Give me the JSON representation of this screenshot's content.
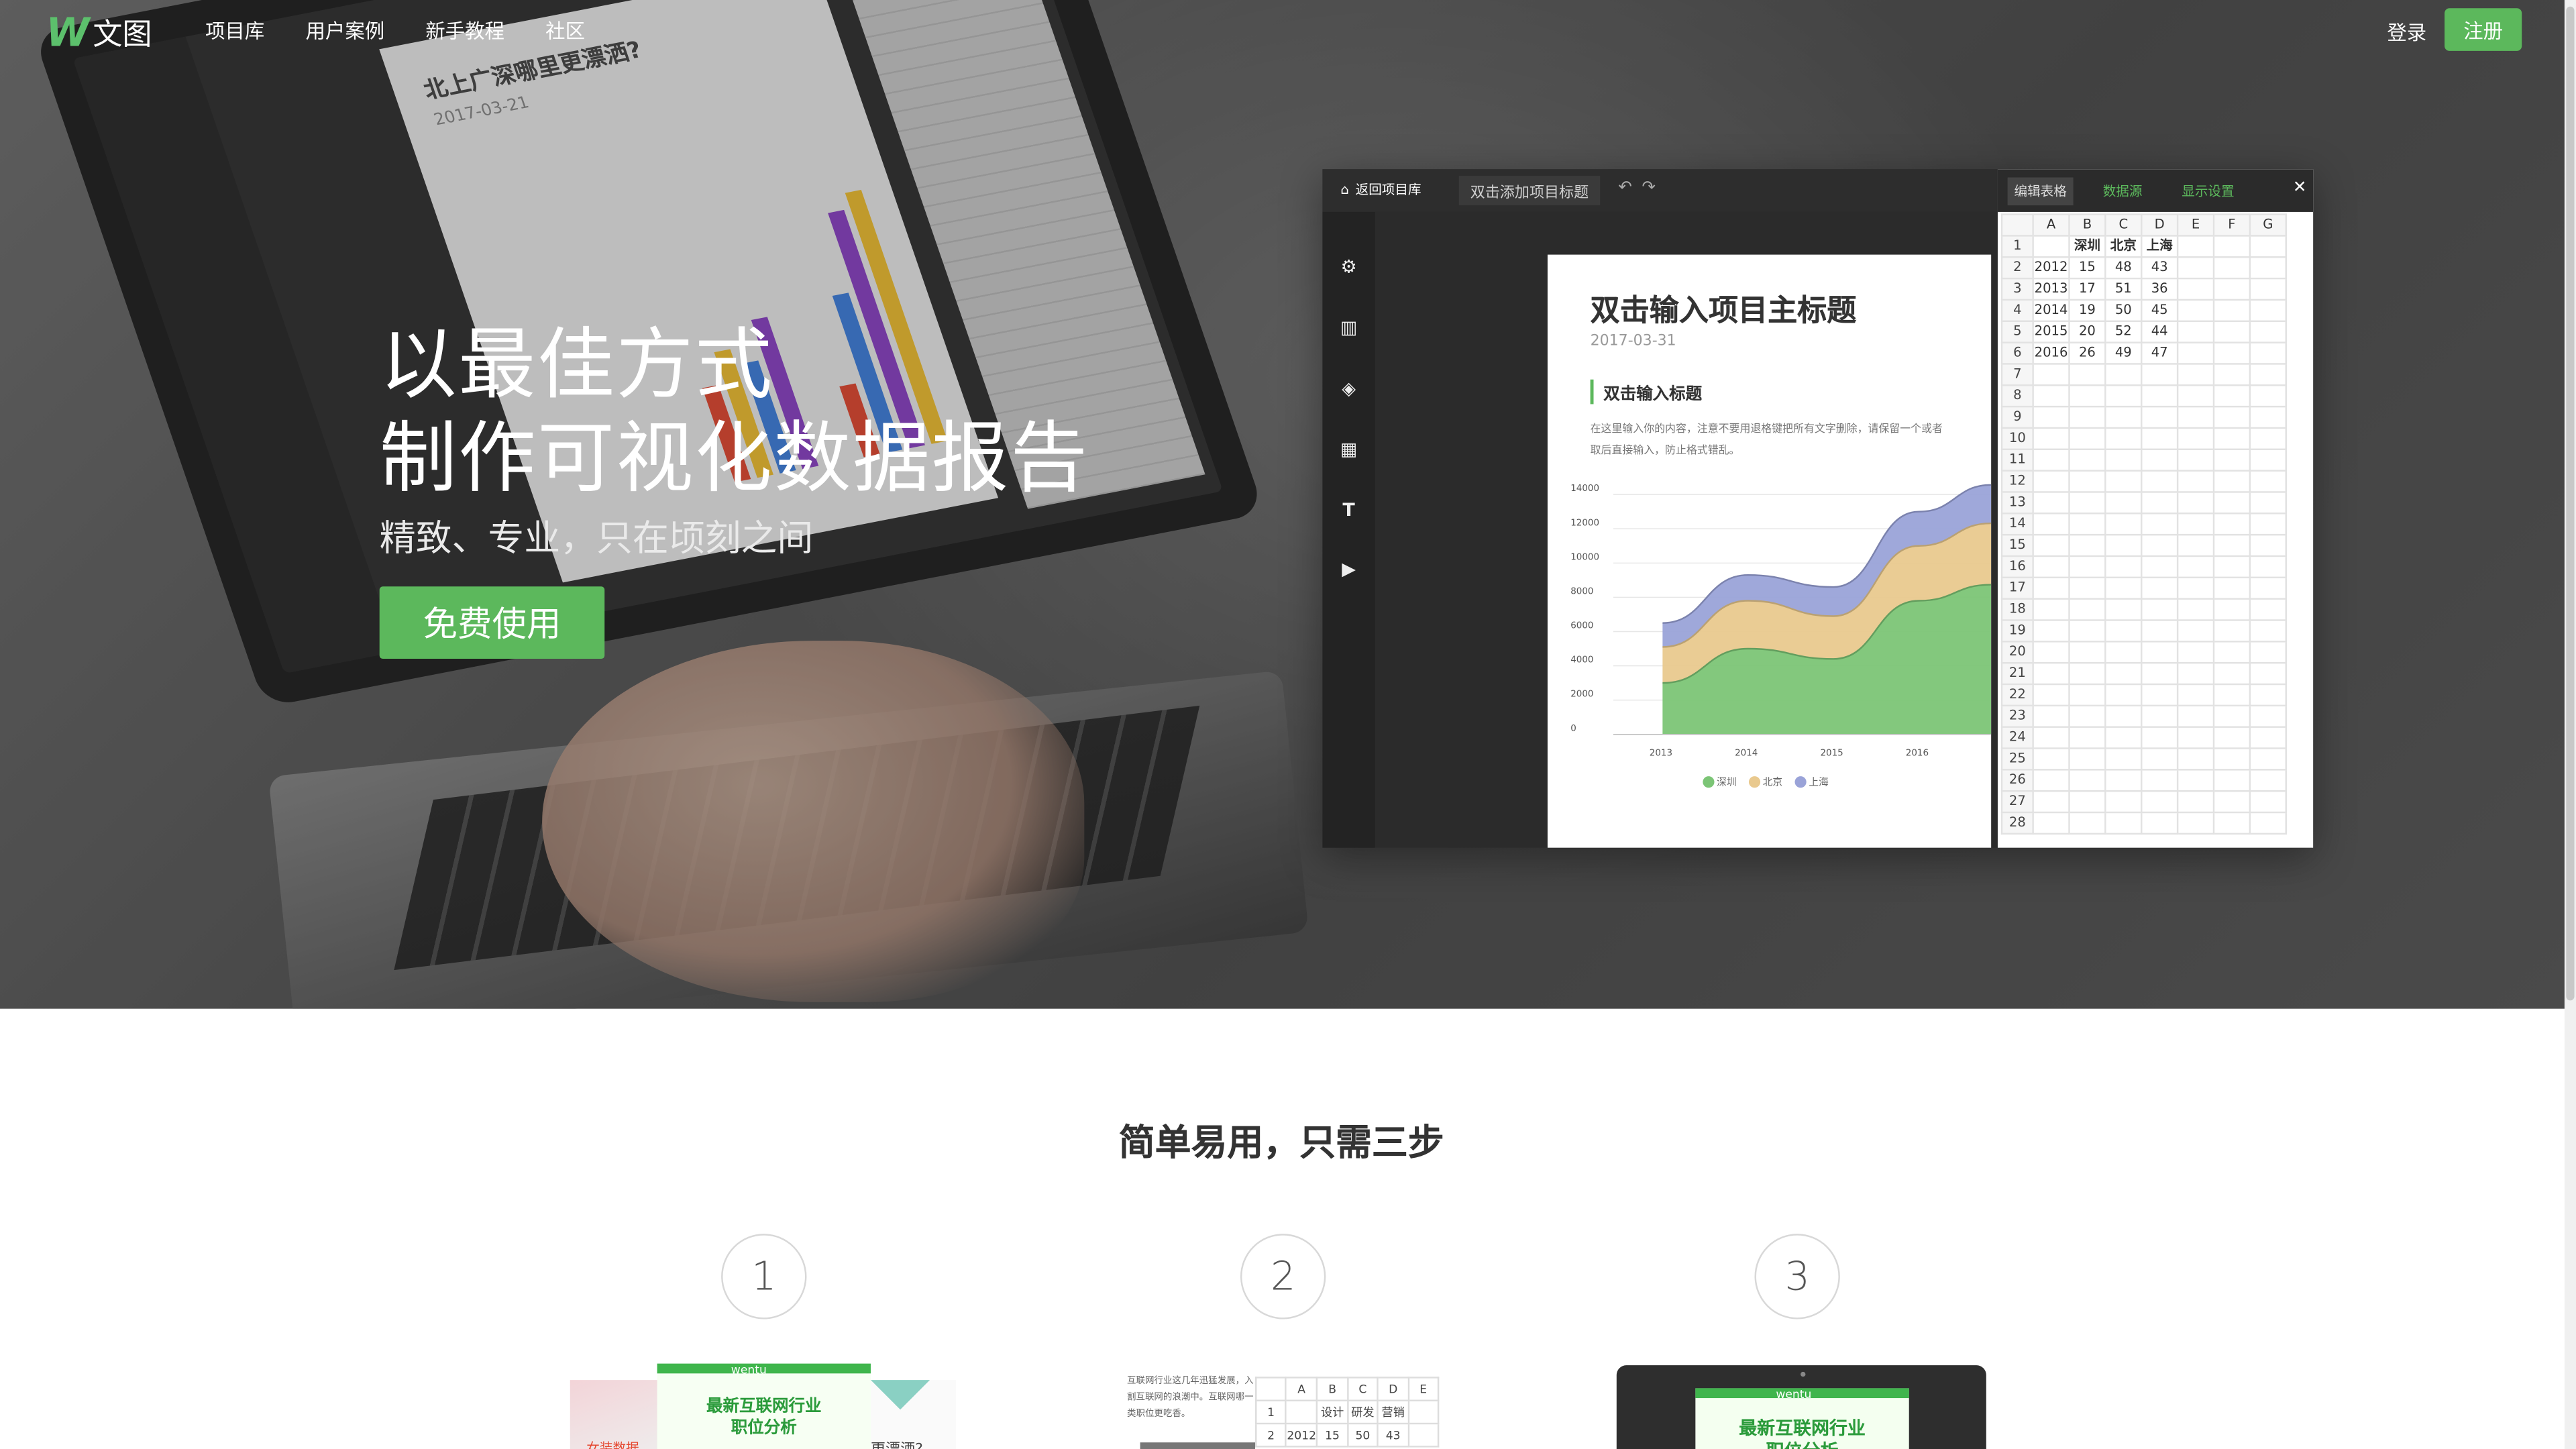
{
  "nav": {
    "logo_text": "文图",
    "links": [
      "项目库",
      "用户案例",
      "新手教程",
      "社区"
    ],
    "login": "登录",
    "register": "注册"
  },
  "hero": {
    "headline_1": "以最佳方式",
    "headline_2": "制作可视化数据报告",
    "subtitle": "精致、专业，只在顷刻之间",
    "cta": "免费使用",
    "laptop_screen_title": "北上广深哪里更漂洒?",
    "laptop_screen_date": "2017-03-21"
  },
  "editor": {
    "back_label": "返回项目库",
    "title_placeholder": "双击添加项目标题",
    "doc_title": "双击输入项目主标题",
    "doc_date": "2017-03-31",
    "doc_heading": "双击输入标题",
    "doc_paragraph_1": "在这里输入你的内容，注意不要用退格键把所有文字删除，请保留一个或者",
    "doc_paragraph_2": "取后直接输入，防止格式错乱。",
    "sheet_tabs": [
      "编辑表格",
      "数据源",
      "显示设置"
    ],
    "sheet_columns": [
      "A",
      "B",
      "C",
      "D",
      "E",
      "F",
      "G"
    ],
    "sheet_header_row": [
      "",
      "深圳",
      "北京",
      "上海"
    ]
  },
  "chart_data": {
    "type": "area",
    "x": [
      "2013",
      "2014",
      "2015",
      "2016"
    ],
    "x_ticks": [
      "2013",
      "2014",
      "2015",
      "2016"
    ],
    "y_ticks": [
      "0",
      "2000",
      "4000",
      "6000",
      "8000",
      "10000",
      "12000",
      "14000"
    ],
    "ylim": [
      0,
      14000
    ],
    "stacked": true,
    "series": [
      {
        "name": "深圳",
        "color": "#7cc576",
        "values": [
          3000,
          5000,
          4400,
          7800
        ]
      },
      {
        "name": "北京",
        "color": "#e9c98e",
        "values": [
          2100,
          2800,
          2500,
          3200
        ]
      },
      {
        "name": "上海",
        "color": "#9aa3d8",
        "values": [
          1400,
          1500,
          1700,
          2000
        ]
      }
    ],
    "legend": [
      "深圳",
      "北京",
      "上海"
    ],
    "legend_position": "bottom"
  },
  "sheet_rows": [
    [
      "2012",
      "15",
      "48",
      "43"
    ],
    [
      "2013",
      "17",
      "51",
      "36"
    ],
    [
      "2014",
      "19",
      "50",
      "45"
    ],
    [
      "2015",
      "20",
      "52",
      "44"
    ],
    [
      "2016",
      "26",
      "49",
      "47"
    ]
  ],
  "section": {
    "title": "简单易用，只需三步",
    "steps": [
      "1",
      "2",
      "3"
    ],
    "thumb1_brand": "wentu",
    "thumb1_title_1": "最新互联网行业",
    "thumb1_title_2": "职位分析",
    "thumb1_left_text": "女装数据",
    "thumb1_right_text": "更漂洒?",
    "thumb2_text": "互联网行业这几年迅猛发展，入割互联网的浪潮中。互联网哪一类职位更吃香。",
    "thumb2_columns": [
      "A",
      "B",
      "C",
      "D",
      "E"
    ],
    "thumb2_row1": [
      "1",
      "",
      "设计",
      "研发",
      "营销"
    ],
    "thumb2_row2": [
      "2",
      "2012",
      "15",
      "50",
      "43"
    ],
    "thumb3_brand": "wentu",
    "thumb3_title_1": "最新互联网行业",
    "thumb3_title_2": "职位分析"
  }
}
